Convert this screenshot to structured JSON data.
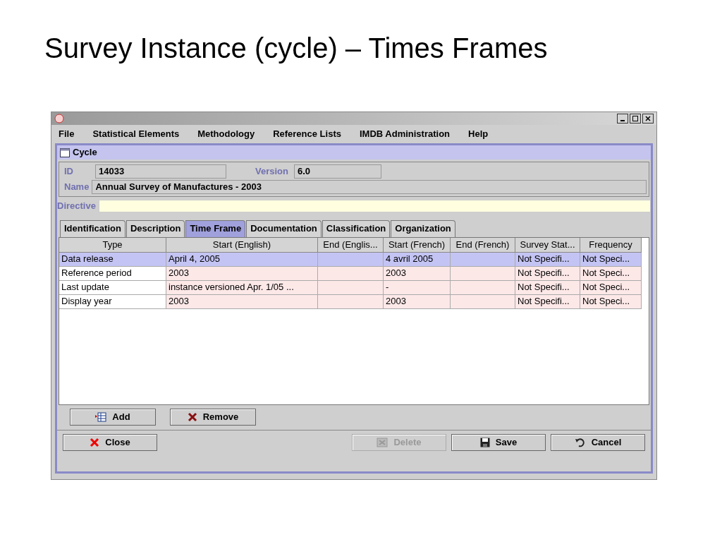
{
  "slide_title": "Survey Instance (cycle) – Times Frames",
  "menu": [
    "File",
    "Statistical Elements",
    "Methodology",
    "Reference Lists",
    "IMDB Administration",
    "Help"
  ],
  "frame": {
    "title": "Cycle"
  },
  "fields": {
    "id_label": "ID",
    "id": "14033",
    "version_label": "Version",
    "version": "6.0",
    "name_label": "Name",
    "name": "Annual Survey of Manufactures - 2003",
    "directive_label": "Directive"
  },
  "tabs": [
    {
      "label": "Identification",
      "selected": false
    },
    {
      "label": "Description",
      "selected": false
    },
    {
      "label": "Time Frame",
      "selected": true
    },
    {
      "label": "Documentation",
      "selected": false
    },
    {
      "label": "Classification",
      "selected": false
    },
    {
      "label": "Organization",
      "selected": false
    }
  ],
  "table": {
    "columns": [
      "Type",
      "Start (English)",
      "End (Englis...",
      "Start (French)",
      "End (French)",
      "Survey Stat...",
      "Frequency"
    ],
    "rows": [
      {
        "selected": true,
        "cells": [
          "Data release",
          "April 4, 2005",
          "",
          "4 avril 2005",
          "",
          "Not Specifi...",
          "Not Speci..."
        ]
      },
      {
        "selected": false,
        "cells": [
          "Reference period",
          "2003",
          "",
          "2003",
          "",
          "Not Specifi...",
          "Not Speci..."
        ]
      },
      {
        "selected": false,
        "cells": [
          "Last update",
          "instance versioned Apr. 1/05 ...",
          "",
          "-",
          "",
          "Not Specifi...",
          "Not Speci..."
        ]
      },
      {
        "selected": false,
        "cells": [
          "Display year",
          "2003",
          "",
          "2003",
          "",
          "Not Specifi...",
          "Not Speci..."
        ]
      }
    ]
  },
  "table_buttons": [
    {
      "label": "Add",
      "kind": "add",
      "disabled": false
    },
    {
      "label": "Remove",
      "kind": "remove",
      "disabled": false
    }
  ],
  "footer_buttons": [
    {
      "label": "Close",
      "kind": "close",
      "disabled": false
    },
    {
      "label": "Delete",
      "kind": "delete",
      "disabled": true
    },
    {
      "label": "Save",
      "kind": "save",
      "disabled": false
    },
    {
      "label": "Cancel",
      "kind": "cancel",
      "disabled": false
    }
  ]
}
